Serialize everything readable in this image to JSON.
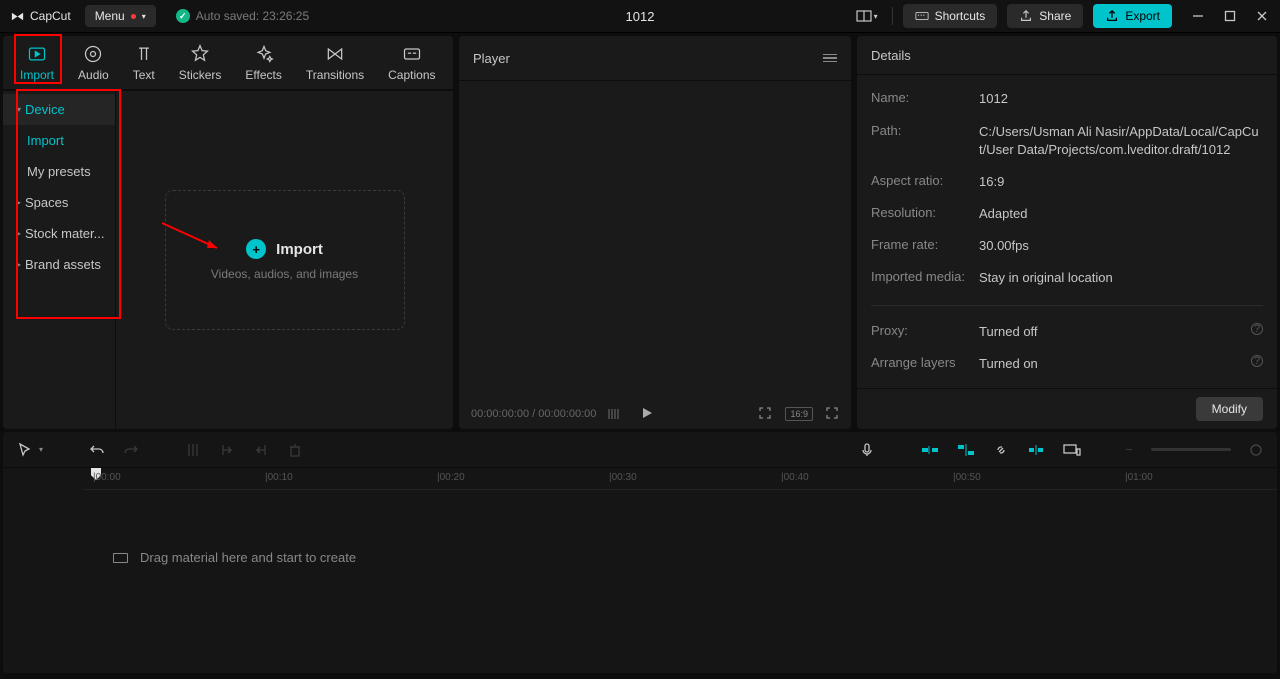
{
  "titlebar": {
    "app_name": "CapCut",
    "menu_label": "Menu",
    "autosave_label": "Auto saved: 23:26:25",
    "project_title": "1012",
    "shortcuts_label": "Shortcuts",
    "share_label": "Share",
    "export_label": "Export"
  },
  "media_tabs": {
    "import": "Import",
    "audio": "Audio",
    "text": "Text",
    "stickers": "Stickers",
    "effects": "Effects",
    "transitions": "Transitions",
    "captions": "Captions"
  },
  "sidebar": {
    "device": "Device",
    "import": "Import",
    "my_presets": "My presets",
    "spaces": "Spaces",
    "stock_material": "Stock mater...",
    "brand_assets": "Brand assets"
  },
  "import_drop": {
    "title": "Import",
    "subtitle": "Videos, audios, and images"
  },
  "player": {
    "title": "Player",
    "time_current": "00:00:00:00",
    "time_total": "00:00:00:00",
    "ratio_badge": "16:9"
  },
  "details": {
    "title": "Details",
    "rows": {
      "name_label": "Name:",
      "name_value": "1012",
      "path_label": "Path:",
      "path_value": "C:/Users/Usman Ali Nasir/AppData/Local/CapCut/User Data/Projects/com.lveditor.draft/1012",
      "aspect_label": "Aspect ratio:",
      "aspect_value": "16:9",
      "resolution_label": "Resolution:",
      "resolution_value": "Adapted",
      "framerate_label": "Frame rate:",
      "framerate_value": "30.00fps",
      "imported_label": "Imported media:",
      "imported_value": "Stay in original location",
      "proxy_label": "Proxy:",
      "proxy_value": "Turned off",
      "arrange_label": "Arrange layers",
      "arrange_value": "Turned on"
    },
    "modify_label": "Modify"
  },
  "timeline": {
    "ticks": [
      "00:00",
      "00:10",
      "00:20",
      "00:30",
      "00:40",
      "00:50",
      "01:00"
    ],
    "drop_hint": "Drag material here and start to create"
  }
}
